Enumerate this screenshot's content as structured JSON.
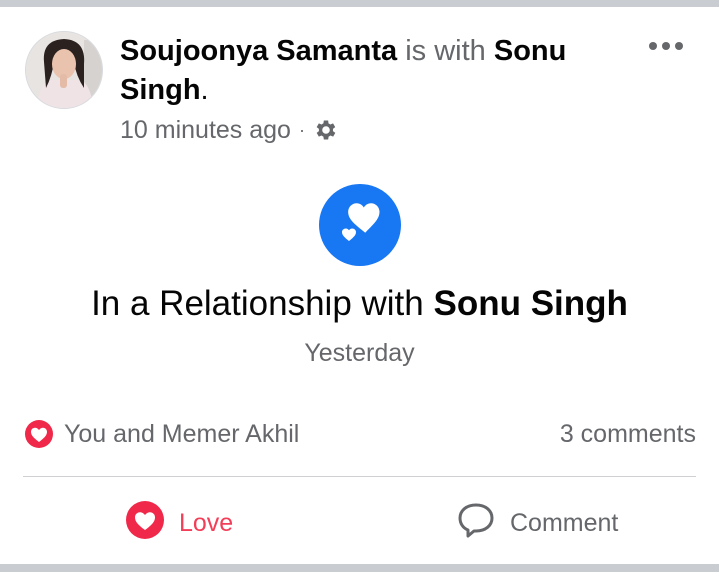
{
  "post": {
    "author": "Soujoonya Samanta",
    "with_text": "is with",
    "tagged": "Sonu Singh",
    "end_punct": ".",
    "timestamp": "10 minutes ago",
    "separator": "·",
    "privacy_icon": "gear-icon",
    "more_icon": "more-dots-icon"
  },
  "life_event": {
    "icon": "hearts-icon",
    "title_prefix": "In a Relationship with",
    "title_name": "Sonu Singh",
    "date": "Yesterday"
  },
  "summary": {
    "reaction_icon": "love-reaction-icon",
    "reactors": "You and Memer Akhil",
    "comments": "3 comments"
  },
  "actions": {
    "love_label": "Love",
    "comment_label": "Comment"
  },
  "colors": {
    "brand_blue": "#1877f2",
    "love_red": "#f33e58",
    "secondary_text": "#65676b",
    "divider": "#ced0d4"
  }
}
